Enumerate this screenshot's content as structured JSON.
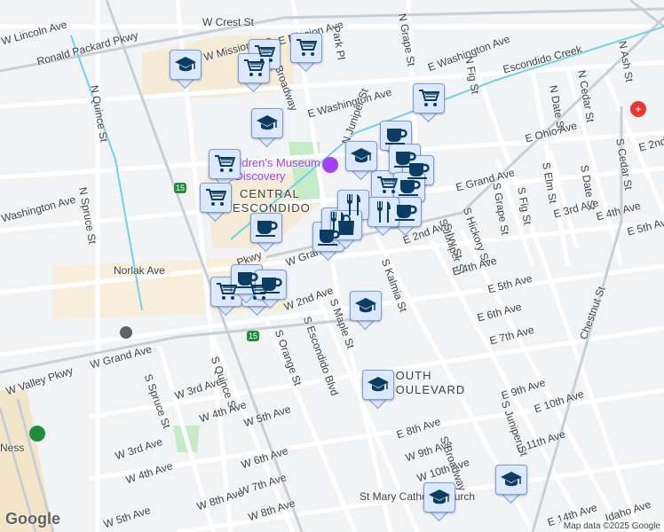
{
  "map": {
    "area_labels": {
      "central": "CENTRAL",
      "escondido": "ESCONDIDO",
      "south": "SOUTH",
      "boulevard": "BOULEVARD"
    },
    "poi": {
      "museum_line1": "Children's Museum",
      "museum_line2": "of Discovery"
    },
    "highway_shield": "15",
    "streets": [
      "W Lincoln Ave",
      "Ronald Packard Pkwy",
      "W Crest St",
      "E Mission Ave",
      "W Mission Ave",
      "Park Pl",
      "Broadway",
      "N Grape St",
      "E Washington Ave",
      "N Fig St",
      "Escondido Creek",
      "E Washington Ave",
      "N Juniper St",
      "N Date St",
      "N Cedar St",
      "N Ash St",
      "E Ohio Ave",
      "E 2nd",
      "E Grand Ave",
      "S Grape St",
      "S Fig St",
      "S Elm St",
      "S Date St",
      "S Cedar St",
      "E 3rd Ave",
      "E 4th Ave",
      "E 5th Ave",
      "N Quince St",
      "N Spruce St",
      "Washington Ave",
      "Norlak Ave",
      "Pkwy",
      "W Grand Ave",
      "E 2nd Ave",
      "S Juniper St",
      "S Ivy St",
      "S Hickory St",
      "E 4th Ave",
      "E 5th Ave",
      "E 6th Ave",
      "E 7th Ave",
      "S Kalmia St",
      "W 2nd Ave",
      "S Maple St",
      "S Escondido Blvd",
      "S Orange St",
      "W Valley Pkwy",
      "W Grand Ave",
      "S Spruce St",
      "W 3rd Ave",
      "S Quince St",
      "W 4th Ave",
      "W 5th Ave",
      "W 6th Ave",
      "W 7th Ave",
      "W 8th Ave",
      "W 3rd Ave",
      "W 4th Ave",
      "W 5th Ave",
      "E 8th Ave",
      "W 9th Ave",
      "W 10th Ave",
      "S Broadway",
      "E 9th Ave",
      "E 10th Ave",
      "E 11th Ave",
      "S Juniper St",
      "Chestnut St",
      "St Mary Catholic Church",
      "E 14th Ave",
      "Idaho Ave",
      "Ness",
      "W 8th Ave"
    ],
    "markers": [
      {
        "type": "shopping-cart"
      },
      {
        "type": "shopping-cart"
      },
      {
        "type": "shopping-cart"
      },
      {
        "type": "shopping-cart"
      },
      {
        "type": "shopping-cart"
      },
      {
        "type": "shopping-cart"
      },
      {
        "type": "shopping-cart"
      },
      {
        "type": "shopping-cart"
      },
      {
        "type": "shopping-cart"
      },
      {
        "type": "graduation-cap"
      },
      {
        "type": "graduation-cap"
      },
      {
        "type": "graduation-cap"
      },
      {
        "type": "graduation-cap"
      },
      {
        "type": "graduation-cap"
      },
      {
        "type": "graduation-cap"
      },
      {
        "type": "graduation-cap"
      },
      {
        "type": "coffee-cup"
      },
      {
        "type": "coffee-cup"
      },
      {
        "type": "coffee-cup"
      },
      {
        "type": "coffee-cup"
      },
      {
        "type": "coffee-cup"
      },
      {
        "type": "coffee-cup"
      },
      {
        "type": "coffee-cup"
      },
      {
        "type": "coffee-cup"
      },
      {
        "type": "coffee-cup"
      },
      {
        "type": "fork-knife"
      },
      {
        "type": "fork-knife"
      },
      {
        "type": "fork-knife"
      },
      {
        "type": "shopping-bag"
      }
    ]
  },
  "attribution": "Map data ©2025 Google",
  "logo": "Google",
  "colors": {
    "marker_fill": "#dce8fb",
    "marker_icon": "#0b3d63",
    "road": "#ffffff",
    "highway": "#9aa6b2",
    "water": "#6fd3e8",
    "park": "#c6ebc9",
    "hospital": "#e53935"
  }
}
